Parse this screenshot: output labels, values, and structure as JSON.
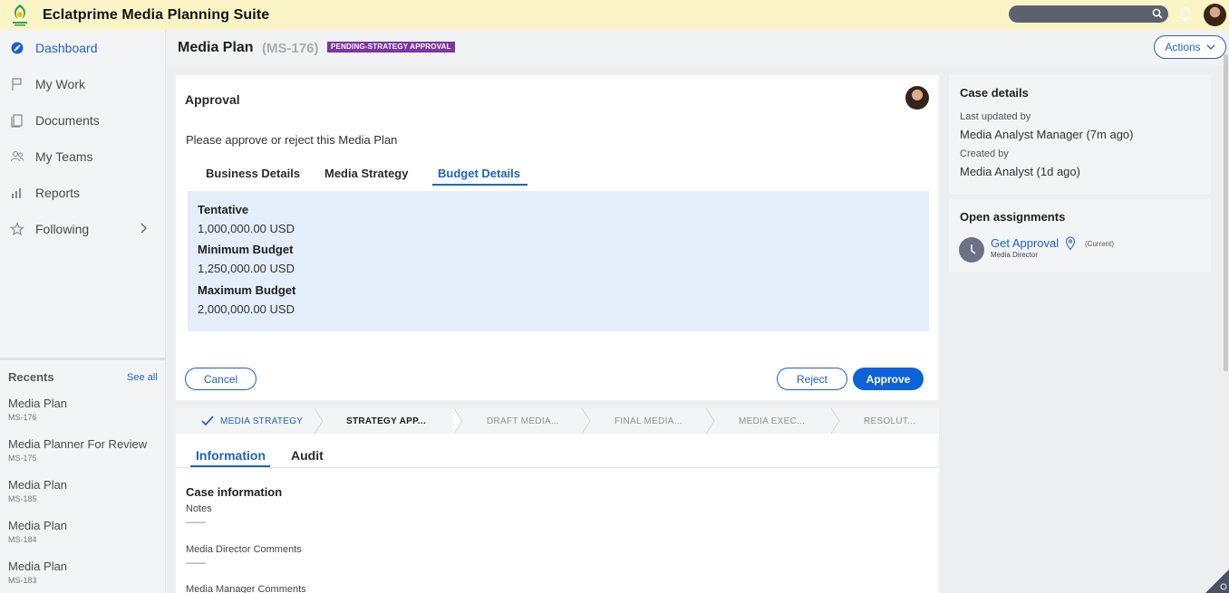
{
  "app": {
    "title": "Eclatprime Media Planning Suite"
  },
  "colors": {
    "accent": "#1b63c9",
    "badge": "#7b35a4",
    "topbar": "#fbf4c6",
    "budget_bg": "#e4edfa"
  },
  "sidebar": {
    "items": [
      {
        "label": "Dashboard",
        "icon": "dashboard-icon",
        "active": true
      },
      {
        "label": "My Work",
        "icon": "flag-icon"
      },
      {
        "label": "Documents",
        "icon": "document-icon"
      },
      {
        "label": "My Teams",
        "icon": "teams-icon"
      },
      {
        "label": "Reports",
        "icon": "reports-icon"
      },
      {
        "label": "Following",
        "icon": "star-icon"
      }
    ],
    "recents": {
      "heading": "Recents",
      "see_all": "See all",
      "items": [
        {
          "title": "Media Plan",
          "id": "MS-176"
        },
        {
          "title": "Media Planner For Review",
          "id": "MS-175"
        },
        {
          "title": "Media Plan",
          "id": "MS-185"
        },
        {
          "title": "Media Plan",
          "id": "MS-184"
        },
        {
          "title": "Media Plan",
          "id": "MS-183"
        }
      ]
    }
  },
  "header": {
    "title": "Media Plan",
    "case_id": "(MS-176)",
    "status": "PENDING-STRATEGY APPROVAL",
    "actions_label": "Actions"
  },
  "approval": {
    "title": "Approval",
    "instruction": "Please approve or reject this Media Plan",
    "tabs": [
      "Business Details",
      "Media Strategy",
      "Budget Details"
    ],
    "active_tab": "Budget Details",
    "fields": [
      {
        "label": "Tentative",
        "value": "1,000,000.00 USD"
      },
      {
        "label": "Minimum Budget",
        "value": "1,250,000.00 USD"
      },
      {
        "label": "Maximum Budget",
        "value": "2,000,000.00 USD"
      }
    ],
    "cancel_label": "Cancel",
    "reject_label": "Reject",
    "approve_label": "Approve"
  },
  "stages": [
    {
      "label": "MEDIA STRATEGY",
      "state": "done"
    },
    {
      "label": "STRATEGY APP...",
      "state": "current"
    },
    {
      "label": "DRAFT MEDIA...",
      "state": "future"
    },
    {
      "label": "FINAL MEDIA...",
      "state": "future"
    },
    {
      "label": "MEDIA EXEC...",
      "state": "future"
    },
    {
      "label": "RESOLUT...",
      "state": "future"
    }
  ],
  "info": {
    "tabs": [
      "Information",
      "Audit"
    ],
    "heading": "Case information",
    "fields": [
      {
        "label": "Notes",
        "value": "——"
      },
      {
        "label": "Media Director Comments",
        "value": "——"
      },
      {
        "label": "Media Manager Comments",
        "value": ""
      }
    ]
  },
  "case_details": {
    "heading": "Case details",
    "last_updated_label": "Last updated by",
    "last_updated_value": "Media Analyst Manager (7m ago)",
    "created_label": "Created by",
    "created_value": "Media Analyst (1d ago)"
  },
  "assignments": {
    "heading": "Open assignments",
    "link": "Get Approval",
    "current": "(Current)",
    "assignee": "Media Director"
  }
}
